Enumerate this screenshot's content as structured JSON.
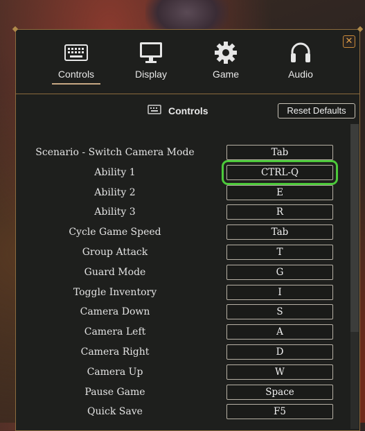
{
  "tabs": [
    {
      "label": "Controls",
      "icon": "keyboard-icon",
      "active": true
    },
    {
      "label": "Display",
      "icon": "monitor-icon",
      "active": false
    },
    {
      "label": "Game",
      "icon": "gear-icon",
      "active": false
    },
    {
      "label": "Audio",
      "icon": "headphones-icon",
      "active": false
    }
  ],
  "section": {
    "title": "Controls",
    "icon": "keyboard-icon"
  },
  "reset_label": "Reset Defaults",
  "close_icon": "close-icon",
  "accent_color": "#4cc93a",
  "bindings": [
    {
      "action": "Scenario - Switch Camera Mode",
      "key": "Tab"
    },
    {
      "action": "Ability 1",
      "key": "CTRL-Q",
      "selected": true
    },
    {
      "action": "Ability 2",
      "key": "E"
    },
    {
      "action": "Ability 3",
      "key": "R"
    },
    {
      "action": "Cycle Game Speed",
      "key": "Tab"
    },
    {
      "action": "Group Attack",
      "key": "T"
    },
    {
      "action": "Guard Mode",
      "key": "G"
    },
    {
      "action": "Toggle Inventory",
      "key": "I"
    },
    {
      "action": "Camera Down",
      "key": "S"
    },
    {
      "action": "Camera Left",
      "key": "A"
    },
    {
      "action": "Camera Right",
      "key": "D"
    },
    {
      "action": "Camera Up",
      "key": "W"
    },
    {
      "action": "Pause Game",
      "key": "Space"
    },
    {
      "action": "Quick Save",
      "key": "F5"
    }
  ]
}
